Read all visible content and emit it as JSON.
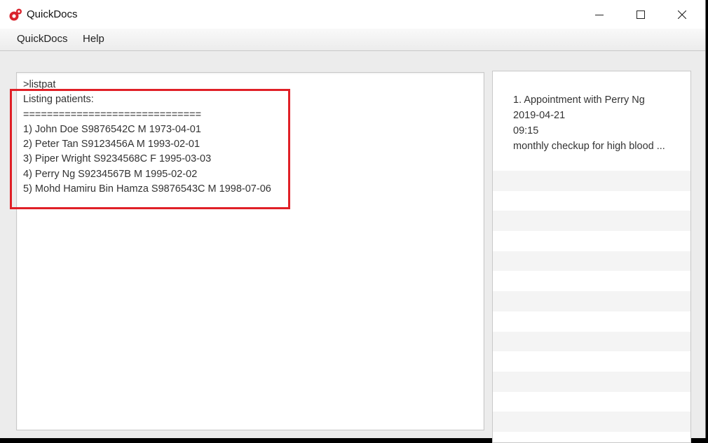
{
  "window": {
    "title": "QuickDocs"
  },
  "menu": {
    "items": [
      "QuickDocs",
      "Help"
    ]
  },
  "output": {
    "lines": [
      ">listpat",
      "Listing patients:",
      "==============================",
      "1) John Doe S9876542C M 1973-04-01",
      "2) Peter Tan S9123456A M 1993-02-01",
      "3) Piper Wright S9234568C F 1995-03-03",
      "4) Perry Ng S9234567B M 1995-02-02",
      "5) Mohd Hamiru Bin Hamza S9876543C M 1998-07-06"
    ]
  },
  "appointments": [
    {
      "title": "1.   Appointment with Perry Ng",
      "date": "2019-04-21",
      "time": "09:15",
      "comment": "monthly checkup for high blood ..."
    }
  ],
  "colors": {
    "highlight": "#e02027",
    "stripe": "#f4f4f4",
    "icon_red": "#d9232d"
  }
}
